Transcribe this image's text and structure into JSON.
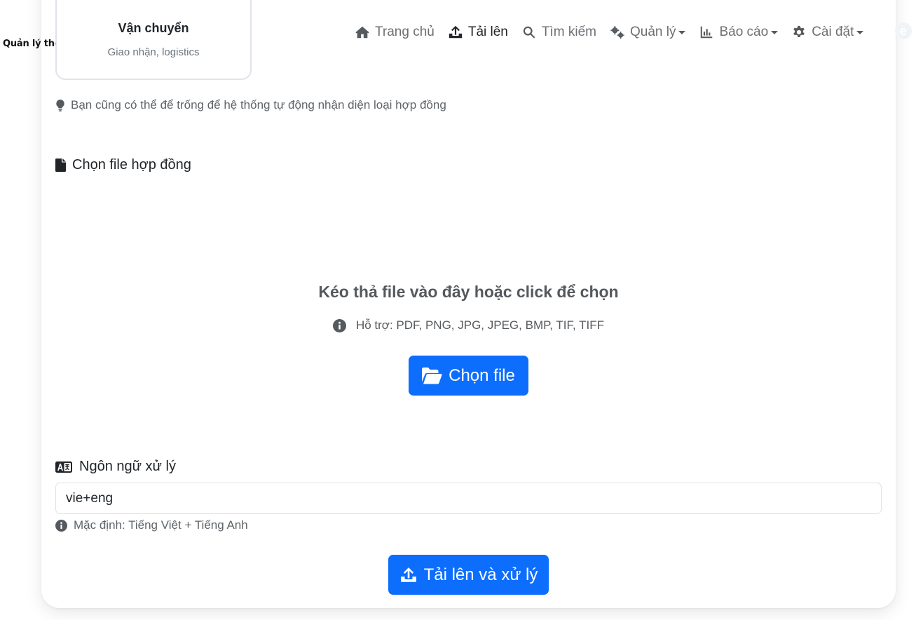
{
  "brand": {
    "tagline": "Quản lý thông minh"
  },
  "contract_type_card": {
    "title": "Vận chuyển",
    "subtitle": "Giao nhận, logistics",
    "accent_color": "#7c58c9"
  },
  "nav": {
    "items": [
      {
        "label": "Trang chủ",
        "icon": "home-icon",
        "active": false,
        "dropdown": false
      },
      {
        "label": "Tải lên",
        "icon": "upload-icon",
        "active": true,
        "dropdown": false
      },
      {
        "label": "Tìm kiếm",
        "icon": "search-icon",
        "active": false,
        "dropdown": false
      },
      {
        "label": "Quản lý",
        "icon": "gears-icon",
        "active": false,
        "dropdown": true
      },
      {
        "label": "Báo cáo",
        "icon": "chart-icon",
        "active": false,
        "dropdown": true
      },
      {
        "label": "Cài đặt",
        "icon": "gear-icon",
        "active": false,
        "dropdown": true
      }
    ]
  },
  "hint": {
    "text": "Bạn cũng có thể để trống để hệ thống tự động nhận diện loại hợp đồng",
    "icon": "lightbulb-icon"
  },
  "file_section": {
    "label": "Chọn file hợp đồng",
    "icon": "file-icon",
    "dropzone_title": "Kéo thả file vào đây hoặc click để chọn",
    "supported_formats": "Hỗ trợ: PDF, PNG, JPG, JPEG, BMP, TIF, TIFF",
    "choose_button": "Chọn file"
  },
  "language_section": {
    "label": "Ngôn ngữ xử lý",
    "icon": "language-icon",
    "value": "vie+eng",
    "help": "Mặc định: Tiếng Việt + Tiếng Anh"
  },
  "submit_button": "Tải lên và xử lý",
  "colors": {
    "primary": "#0d6efd",
    "muted_text": "#6c757d",
    "border": "#dee2e6"
  }
}
